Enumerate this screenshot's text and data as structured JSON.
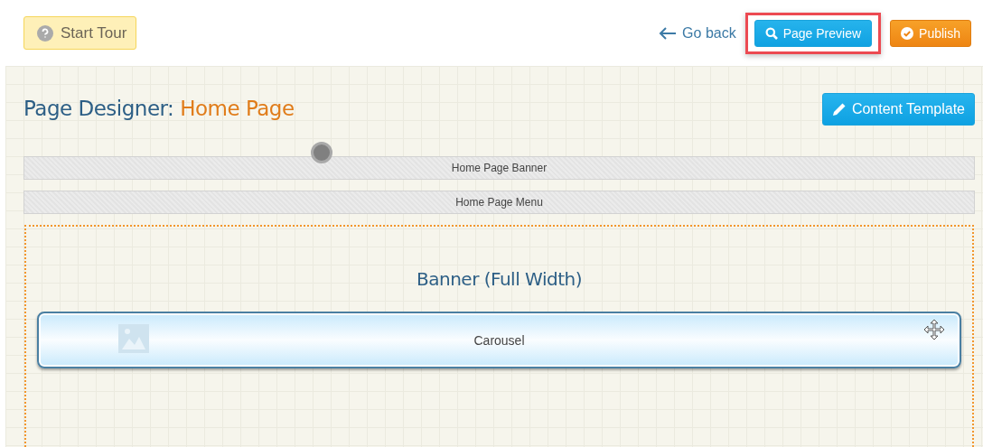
{
  "top_bar": {
    "tour_button": "Start Tour",
    "go_back": "Go back",
    "buttons": [
      {
        "kind": "preview",
        "label": "Page Preview",
        "highlighted": true
      },
      {
        "kind": "publish",
        "label": "Publish",
        "highlighted": false
      }
    ]
  },
  "designer": {
    "title_prefix": "Page Designer:",
    "title_page": "Home Page",
    "template_button": "Content Template",
    "sections": [
      {
        "label": "Home Page Banner",
        "marker": true
      },
      {
        "label": "Home Page Menu",
        "marker": false
      }
    ],
    "zone": {
      "title": "Banner (Full Width)",
      "widgets": [
        {
          "label": "Carousel"
        }
      ]
    }
  }
}
